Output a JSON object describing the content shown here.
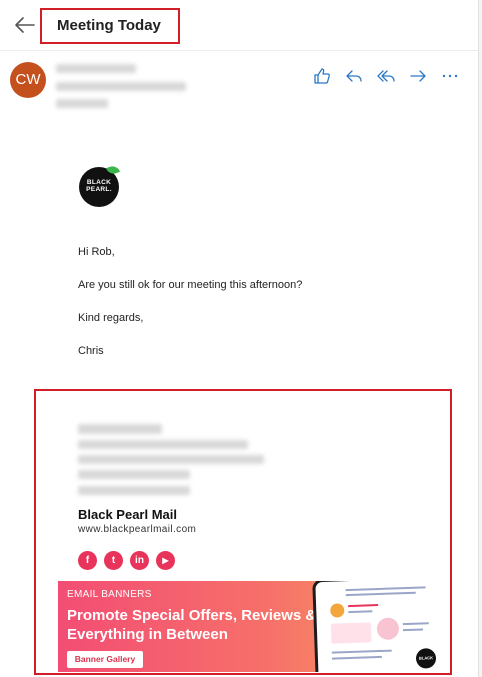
{
  "header": {
    "subject": "Meeting Today"
  },
  "sender": {
    "initials": "CW"
  },
  "actions": [
    "like-icon",
    "reply-icon",
    "reply-all-icon",
    "forward-icon",
    "more-icon"
  ],
  "logo": {
    "text": "BLACK PEARL."
  },
  "message": {
    "greeting": "Hi Rob,",
    "line1": "Are you still ok for our meeting this afternoon?",
    "closing": "Kind regards,",
    "signoff": "Chris"
  },
  "signature": {
    "company": "Black Pearl Mail",
    "website": "www.blackpearlmail.com",
    "social": [
      {
        "icon": "facebook-icon",
        "glyph": "f"
      },
      {
        "icon": "twitter-icon",
        "glyph": "t"
      },
      {
        "icon": "linkedin-icon",
        "glyph": "in"
      },
      {
        "icon": "youtube-icon",
        "glyph": "▶"
      }
    ]
  },
  "banner": {
    "kicker": "EMAIL BANNERS",
    "headline": "Promote Special Offers, Reviews & Everything in Between",
    "button": "Banner Gallery"
  },
  "colors": {
    "highlight": "#d01f26",
    "avatar": "#c4501e",
    "accent": "#2b78c5",
    "social": "#e8345a"
  }
}
